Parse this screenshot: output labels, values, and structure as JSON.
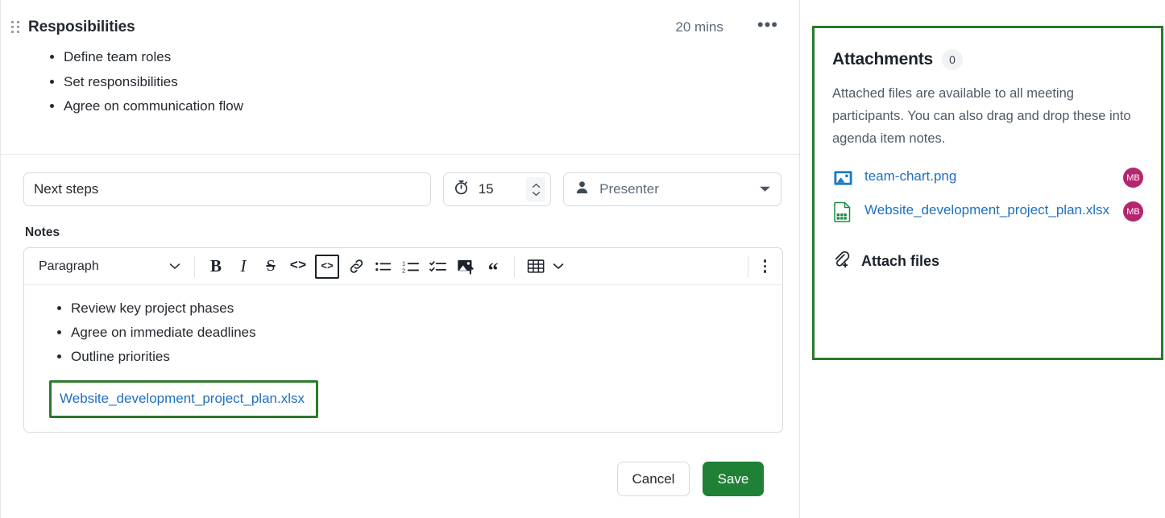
{
  "agenda_item": {
    "drag_handle": "drag-handle",
    "title": "Resposibilities",
    "duration": "20 mins",
    "more_menu": "•••",
    "bullets": [
      "Define team roles",
      "Set responsibilities",
      "Agree on communication flow"
    ]
  },
  "edit_form": {
    "title_value": "Next steps",
    "title_placeholder": "Agenda item title",
    "duration_value": "15",
    "presenter_label": "Presenter",
    "notes_label": "Notes",
    "editor": {
      "style_select": "Paragraph",
      "tools": [
        {
          "name": "bold-button",
          "glyph": "B"
        },
        {
          "name": "italic-button",
          "glyph": "I"
        },
        {
          "name": "strikethrough-button",
          "glyph": "S"
        },
        {
          "name": "inline-code-button",
          "glyph": "<>"
        },
        {
          "name": "code-block-button",
          "glyph": "<>"
        },
        {
          "name": "link-button",
          "glyph": "link"
        },
        {
          "name": "bullet-list-button",
          "glyph": "bullets"
        },
        {
          "name": "numbered-list-button",
          "glyph": "numbers"
        },
        {
          "name": "checklist-button",
          "glyph": "checks"
        },
        {
          "name": "image-button",
          "glyph": "image"
        },
        {
          "name": "blockquote-button",
          "glyph": "“"
        },
        {
          "name": "table-button",
          "glyph": "table"
        }
      ],
      "overflow_menu": "more-options",
      "bullets": [
        "Review key project phases",
        "Agree on immediate deadlines",
        "Outline priorities"
      ],
      "attached_link": "Website_development_project_plan.xlsx"
    },
    "cancel_label": "Cancel",
    "save_label": "Save"
  },
  "attachments": {
    "title": "Attachments",
    "count": "0",
    "description": "Attached files are available to all meeting participants. You can also drag and drop these into agenda item notes.",
    "files": [
      {
        "name": "team-chart.png",
        "icon": "image-file-icon",
        "avatar": "MB"
      },
      {
        "name": "Website_development_project_plan.xlsx",
        "icon": "spreadsheet-file-icon",
        "avatar": "MB"
      }
    ],
    "attach_action": "Attach files"
  },
  "colors": {
    "accent_green": "#1e8136",
    "highlight_green": "#2b7a2b",
    "link_blue": "#1f6fbf",
    "avatar_pink": "#b6256f"
  }
}
